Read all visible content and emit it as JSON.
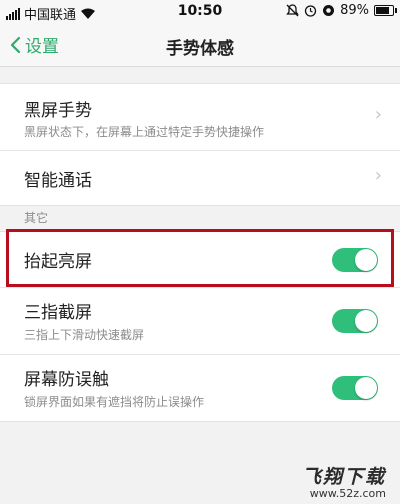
{
  "status_bar": {
    "carrier": "中国联通",
    "time": "10:50",
    "battery": "89%"
  },
  "nav": {
    "back_label": "设置",
    "title": "手势体感"
  },
  "group1": [
    {
      "title": "黑屏手势",
      "subtitle": "黑屏状态下，在屏幕上通过特定手势快捷操作"
    },
    {
      "title": "智能通话"
    }
  ],
  "section_label": "其它",
  "group2": [
    {
      "title": "抬起亮屏",
      "toggle_on": true
    },
    {
      "title": "三指截屏",
      "subtitle": "三指上下滑动快速截屏",
      "toggle_on": true
    },
    {
      "title": "屏幕防误触",
      "subtitle": "锁屏界面如果有遮挡将防止误操作",
      "toggle_on": true
    }
  ],
  "watermark": {
    "main": "飞翔下载",
    "sub": "www.52z.com"
  },
  "colors": {
    "accent": "#2fbf7a",
    "highlight": "#b80d1c"
  }
}
